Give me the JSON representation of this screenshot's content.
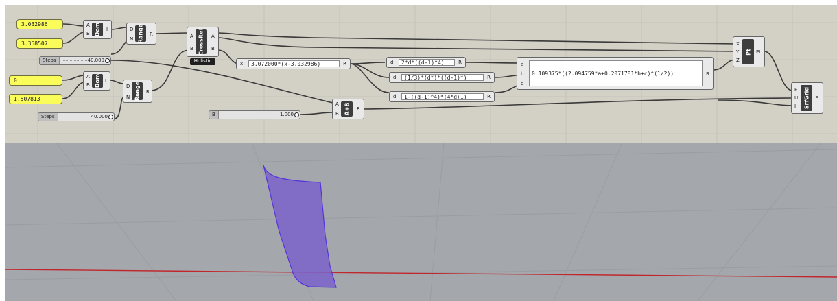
{
  "panels": {
    "p1": "3.032986",
    "p2": "3.358507",
    "p3": "0",
    "p4": "1.507813"
  },
  "sliders": {
    "steps1": {
      "label": "Steps",
      "value": "40.000"
    },
    "steps2": {
      "label": "Steps",
      "value": "40.000"
    },
    "b": {
      "label": "B",
      "value": "1.000"
    }
  },
  "components": {
    "dom1": {
      "name": "Dom",
      "inputs": [
        "A",
        "B"
      ],
      "output": "I"
    },
    "dom2": {
      "name": "Dom",
      "inputs": [
        "A",
        "B"
      ],
      "output": "I"
    },
    "range1": {
      "name": "Range",
      "inputs": [
        "D",
        "N"
      ],
      "output": "R"
    },
    "range2": {
      "name": "Range",
      "inputs": [
        "D",
        "N"
      ],
      "output": "R"
    },
    "crossref": {
      "name": "CrossRef",
      "inputs": [
        "A",
        "B"
      ],
      "outputs": [
        "A",
        "B"
      ],
      "tag": "Holistic"
    },
    "addition": {
      "name": "A+B",
      "inputs": [
        "A",
        "B"
      ],
      "output": "R"
    },
    "pt": {
      "name": "Pt",
      "inputs": [
        "X",
        "Y",
        "Z"
      ],
      "output": "Pt"
    },
    "srfgrid": {
      "name": "SrfGrid",
      "inputs": [
        "P",
        "U",
        "I"
      ],
      "output": "S"
    }
  },
  "expressions": {
    "e1": {
      "input": "x",
      "formula": "3.072000*(x-3.032986)",
      "output": "R"
    },
    "e2": {
      "input": "d",
      "formula": "2*d*((d-1)^4)",
      "output": "R"
    },
    "e3": {
      "input": "d",
      "formula": "(1/3)*(d*)*((d-1)*)",
      "output": "R"
    },
    "e4": {
      "input": "d",
      "formula": "1-((d-1)^4)*(4*d+1)",
      "output": "R"
    },
    "e5": {
      "inputs": [
        "a",
        "b",
        "c"
      ],
      "formula": "0.109375*((2.094759*a+0.2071781*b+c)^(1/2))",
      "output": "R"
    }
  },
  "colors": {
    "canvas": "#d3d0c6",
    "viewport": "#a4a7ab",
    "panel": "#fafc5a",
    "surface": "#7b63c9",
    "surface_edge": "#5533dd",
    "axis_x": "#c0272d"
  }
}
